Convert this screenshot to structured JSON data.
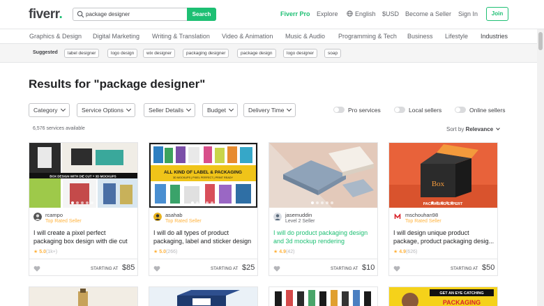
{
  "header": {
    "logo": "fiverr",
    "logo_dot": ".",
    "search_value": "package designer",
    "search_button": "Search",
    "nav": [
      "Fiverr Pro",
      "Explore",
      "English",
      "$USD",
      "Become a Seller",
      "Sign In"
    ],
    "join": "Join"
  },
  "categories": [
    "Graphics & Design",
    "Digital Marketing",
    "Writing & Translation",
    "Video & Animation",
    "Music & Audio",
    "Programming & Tech",
    "Business",
    "Lifestyle",
    "Industries"
  ],
  "suggested": {
    "label": "Suggested",
    "chips": [
      "label designer",
      "logo design",
      "wix designer",
      "packaging designer",
      "package design",
      "logo designer",
      "soap"
    ]
  },
  "results_title": "Results for \"package designer\"",
  "filters": [
    "Category",
    "Service Options",
    "Seller Details",
    "Budget",
    "Delivery Time"
  ],
  "toggles": [
    "Pro services",
    "Local sellers",
    "Online sellers"
  ],
  "services_count": "6,576 services available",
  "sort": {
    "label": "Sort by",
    "value": "Relevance"
  },
  "gigs": [
    {
      "seller": "rcampo",
      "level": "Top Rated Seller",
      "title": "I will create a pixel perfect packaging box design with die cut",
      "rating": "5.0",
      "reviews": "(1k+)",
      "starting": "STARTING AT",
      "price": "$85"
    },
    {
      "seller": "asahab",
      "level": "Top Rated Seller",
      "title": "I will do all types of product packaging, label and sticker design",
      "rating": "5.0",
      "reviews": "(266)",
      "starting": "STARTING AT",
      "price": "$25"
    },
    {
      "seller": "jasemuddin",
      "level": "Level 2 Seller",
      "title": "I will do product packaging design and 3d mockup rendering",
      "rating": "4.9",
      "reviews": "(42)",
      "starting": "STARTING AT",
      "price": "$10"
    },
    {
      "seller": "mschouhan98",
      "level": "Top Rated Seller",
      "title": "I will design unique product package, product packaging desig...",
      "rating": "4.9",
      "reviews": "(626)",
      "starting": "STARTING AT",
      "price": "$50"
    }
  ],
  "thumb_text": {
    "gig1_banner": "BOX DESIGN WITH DIE CUT + 3D MOCKUPS",
    "gig2_banner_a": "ALL KIND OF LABEL & PACKAGING",
    "gig2_banner_b": "3D MOCKUPS | PIXEL PERFECT | PRINT READY",
    "gig4_box": "Box",
    "gig4_banner": "PACKAGING EXPERT",
    "row2_banner": "GET AN EYE CATCHING",
    "row2_banner_b": "PACKAGING"
  },
  "colors": {
    "brand_green": "#1dbf73",
    "top_rated": "#ffb33e"
  }
}
